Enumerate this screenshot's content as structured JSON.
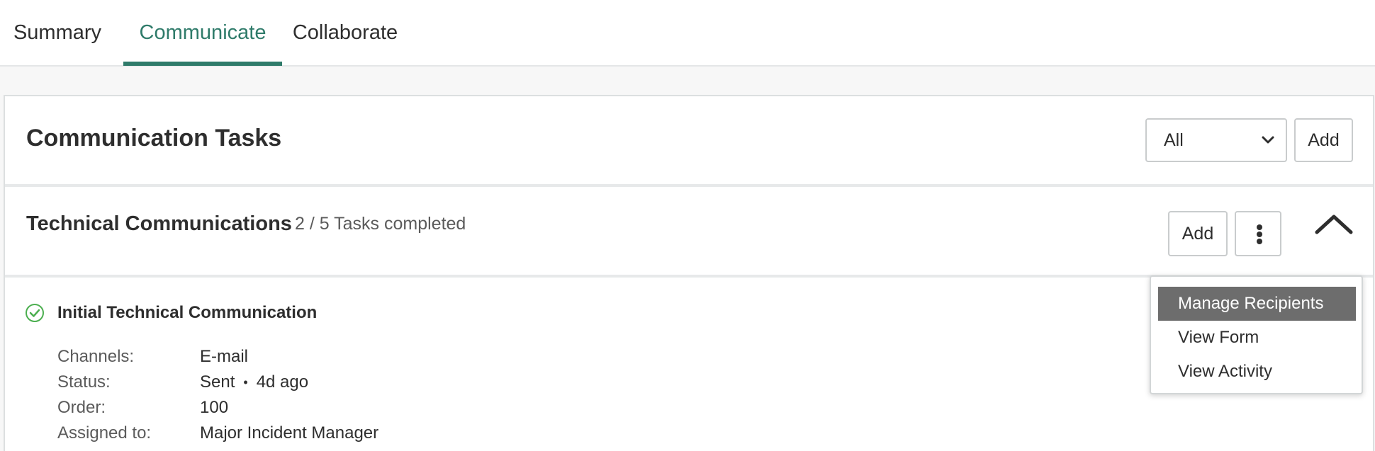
{
  "tabs": [
    {
      "label": "Summary",
      "active": false
    },
    {
      "label": "Communicate",
      "active": true
    },
    {
      "label": "Collaborate",
      "active": false
    }
  ],
  "colors": {
    "accent": "#2f7b6a",
    "success": "#4caf50",
    "menu_highlight": "#6d6d6d"
  },
  "card": {
    "title": "Communication Tasks",
    "filter": {
      "selected": "All"
    },
    "add_label": "Add"
  },
  "section": {
    "title": "Technical Communications",
    "progress_text": "2 / 5 Tasks completed",
    "add_label": "Add"
  },
  "task": {
    "title": "Initial Technical Communication",
    "status_icon": "check-circle-icon",
    "details": {
      "channels_label": "Channels:",
      "channels_value": "E-mail",
      "status_label": "Status:",
      "status_value": "Sent",
      "status_time": "4d ago",
      "order_label": "Order:",
      "order_value": "100",
      "assigned_label": "Assigned to:",
      "assigned_value": "Major Incident Manager"
    }
  },
  "menu": {
    "items": [
      {
        "label": "Manage Recipients",
        "highlighted": true
      },
      {
        "label": "View Form",
        "highlighted": false
      },
      {
        "label": "View Activity",
        "highlighted": false
      }
    ]
  }
}
